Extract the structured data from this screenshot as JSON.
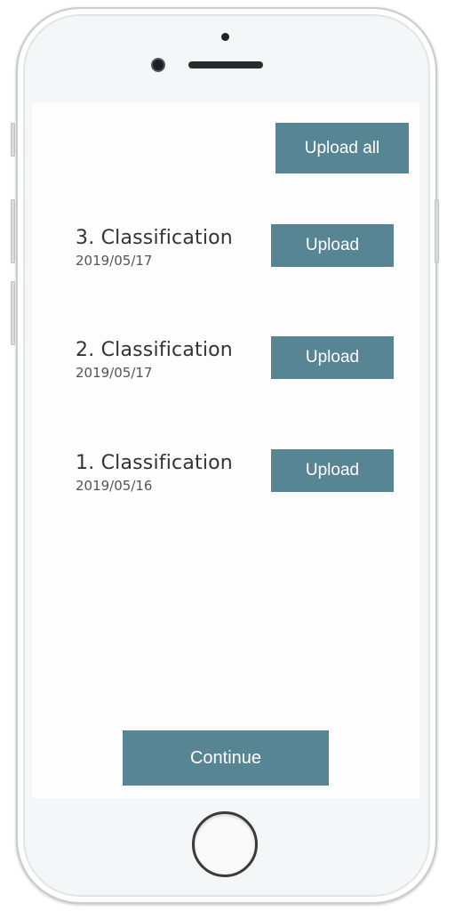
{
  "toolbar": {
    "upload_all_label": "Upload all"
  },
  "items": [
    {
      "title": "3. Classification",
      "date": "2019/05/17",
      "button_label": "Upload"
    },
    {
      "title": "2. Classification",
      "date": "2019/05/17",
      "button_label": "Upload"
    },
    {
      "title": "1. Classification",
      "date": "2019/05/16",
      "button_label": "Upload"
    }
  ],
  "footer": {
    "continue_label": "Continue"
  },
  "colors": {
    "accent": "#578594",
    "text": "#333333"
  }
}
